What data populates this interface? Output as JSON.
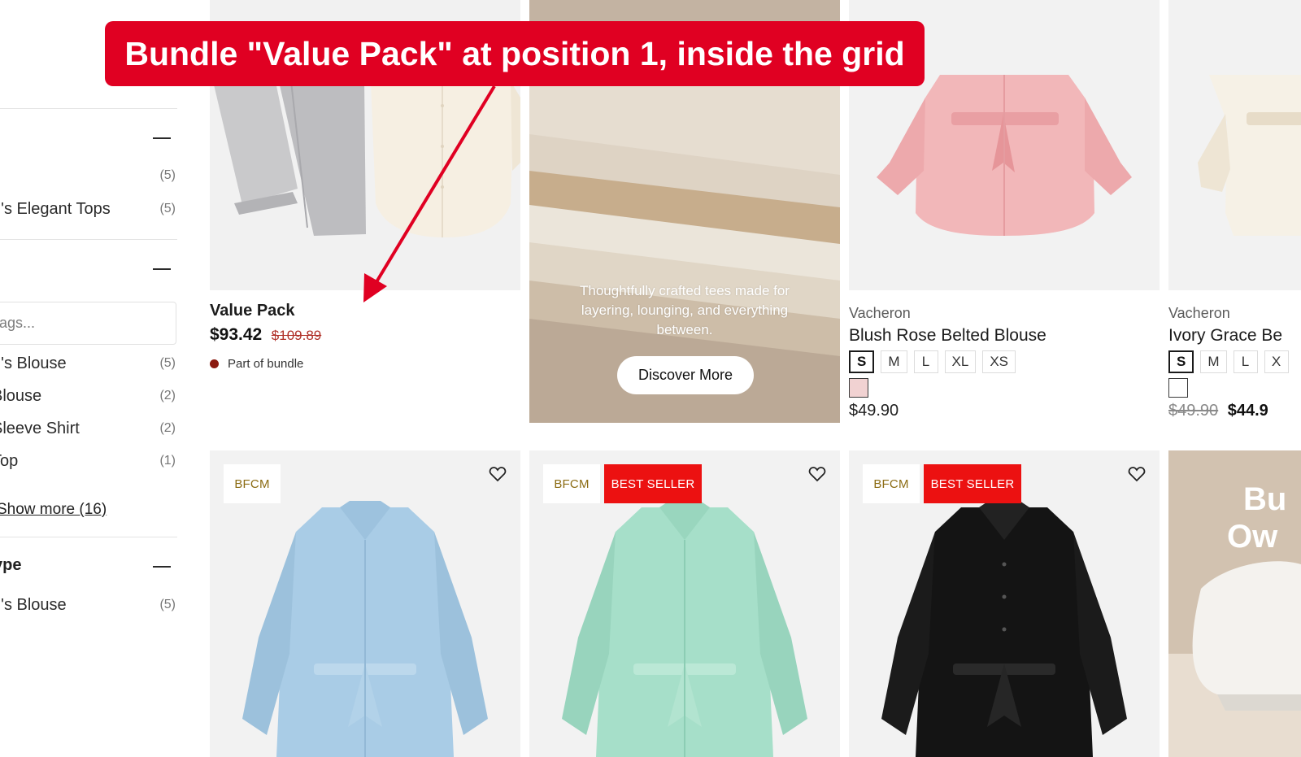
{
  "annotation": {
    "text": "Bundle \"Value Pack\" at position 1, inside the grid"
  },
  "sidebar": {
    "category_rows": [
      {
        "label": "",
        "count": "(5)"
      },
      {
        "label": "n's Elegant Tops",
        "count": "(5)"
      }
    ],
    "search": {
      "placeholder": "ags..."
    },
    "tag_rows": [
      {
        "label": "n's Blouse",
        "count": "(5)"
      },
      {
        "label": " Blouse",
        "count": "(2)"
      },
      {
        "label": "Sleeve Shirt",
        "count": "(2)"
      },
      {
        "label": " Top",
        "count": "(1)"
      }
    ],
    "show_more": "Show more (16)",
    "type_heading": "ype",
    "type_rows": [
      {
        "label": "n's Blouse",
        "count": "(5)"
      }
    ]
  },
  "bundle_card": {
    "name": "Value Pack",
    "price": "$93.42",
    "compare_price": "$109.89",
    "note": "Part of bundle",
    "note_color": "#8b1a10"
  },
  "banner": {
    "text": "Thoughtfully crafted tees made for layering, lounging, and everything between.",
    "button": "Discover More"
  },
  "products_row1": [
    {
      "brand": "Vacheron",
      "name": "Blush Rose Belted Blouse",
      "sizes": [
        "S",
        "M",
        "L",
        "XL",
        "XS"
      ],
      "selected_size": "S",
      "swatch": "#f1d2d2",
      "price": "$49.90"
    },
    {
      "brand": "Vacheron",
      "name": "Ivory Grace Be",
      "sizes": [
        "S",
        "M",
        "L",
        "X"
      ],
      "selected_size": "S",
      "swatch": "#ffffff",
      "compare_price": "$49.90",
      "price": "$44.9"
    }
  ],
  "products_row2": [
    {
      "badges": [
        "BFCM"
      ],
      "color": "#a9cce6"
    },
    {
      "badges": [
        "BFCM",
        "BEST SELLER"
      ],
      "color": "#a6dfc9"
    },
    {
      "badges": [
        "BFCM",
        "BEST SELLER"
      ],
      "color": "#141414"
    }
  ],
  "promo_tile": {
    "text_line1": "Bu",
    "text_line2": "Ow"
  },
  "colors": {
    "accent_red": "#e00022",
    "best_seller_red": "#ec1111",
    "bfcm_text": "#8b6b12"
  }
}
